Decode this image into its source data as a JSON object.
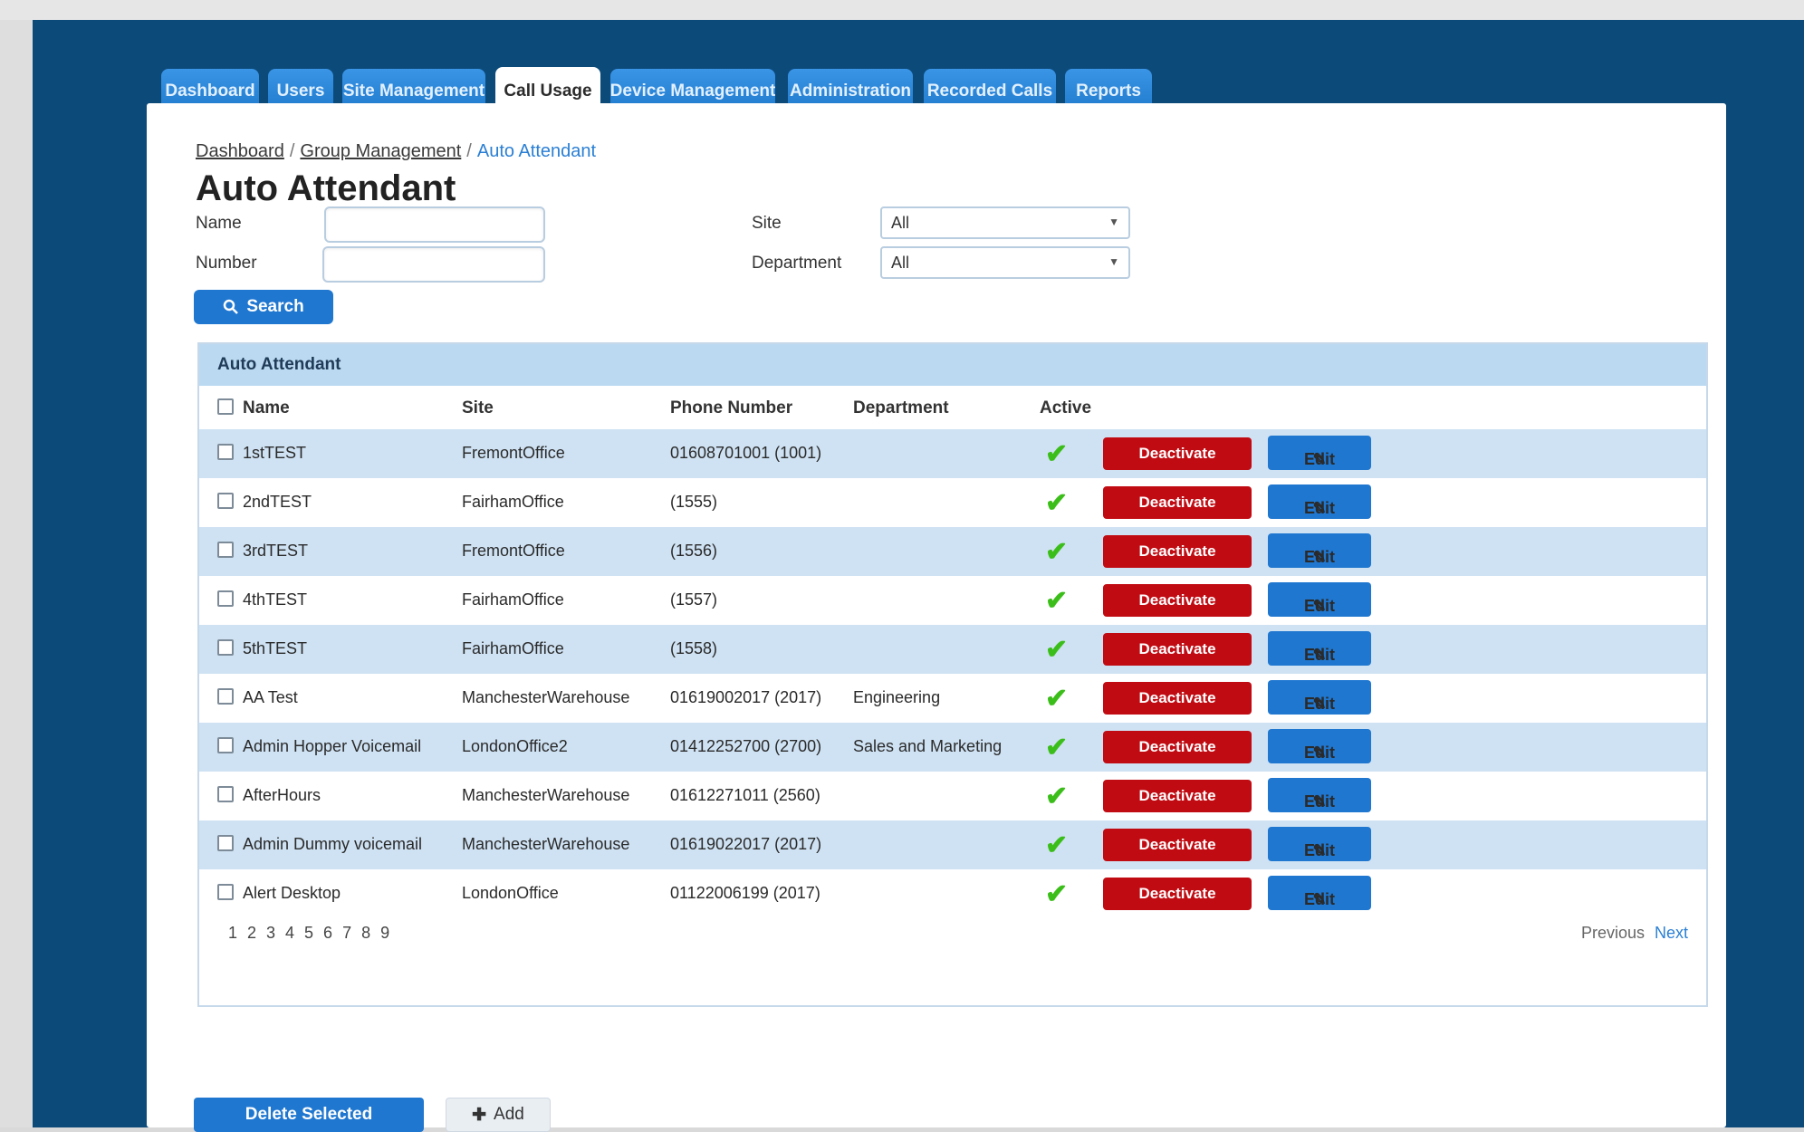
{
  "tabs": [
    {
      "label": "Dashboard"
    },
    {
      "label": "Users"
    },
    {
      "label": "Site Management"
    },
    {
      "label": "Call Usage"
    },
    {
      "label": "Device Management"
    },
    {
      "label": "Administration"
    },
    {
      "label": "Recorded Calls"
    },
    {
      "label": "Reports"
    }
  ],
  "breadcrumb": {
    "items": [
      "Dashboard",
      "Group Management"
    ],
    "current": "Auto Attendant"
  },
  "page_title": "Auto Attendant",
  "filters": {
    "name_label": "Name",
    "number_label": "Number",
    "site_label": "Site",
    "site_value": "All",
    "department_label": "Department",
    "department_value": "All",
    "search_label": "Search"
  },
  "grid": {
    "caption": "Auto Attendant",
    "columns": [
      "Name",
      "Site",
      "Phone Number",
      "Department",
      "Active"
    ],
    "deactivate_label": "Deactivate",
    "edit_label": "Edit",
    "rows": [
      {
        "name": "1stTEST",
        "site": "FremontOffice",
        "phone": "01608701001 (1001)",
        "department": ""
      },
      {
        "name": "2ndTEST",
        "site": "FairhamOffice",
        "phone": "(1555)",
        "department": ""
      },
      {
        "name": "3rdTEST",
        "site": "FremontOffice",
        "phone": "(1556)",
        "department": ""
      },
      {
        "name": "4thTEST",
        "site": "FairhamOffice",
        "phone": "(1557)",
        "department": ""
      },
      {
        "name": "5thTEST",
        "site": "FairhamOffice",
        "phone": "(1558)",
        "department": ""
      },
      {
        "name": "AA Test",
        "site": "ManchesterWarehouse",
        "phone": "01619002017 (2017)",
        "department": "Engineering"
      },
      {
        "name": "Admin Hopper Voicemail",
        "site": "LondonOffice2",
        "phone": "01412252700 (2700)",
        "department": "Sales and Marketing"
      },
      {
        "name": "AfterHours",
        "site": "ManchesterWarehouse",
        "phone": "01612271011 (2560)",
        "department": ""
      },
      {
        "name": "Admin Dummy voicemail",
        "site": "ManchesterWarehouse",
        "phone": "01619022017 (2017)",
        "department": ""
      },
      {
        "name": "Alert Desktop",
        "site": "LondonOffice",
        "phone": "01122006199 (2017)",
        "department": ""
      }
    ],
    "pages": "1 2 3 4 5 6 7 8 9",
    "prev_label": "Previous",
    "next_label": "Next"
  },
  "footer": {
    "delete_label": "Delete Selected",
    "add_label": "Add"
  },
  "colors": {
    "frame": "#0c4a7a",
    "tab": "#2a86dc",
    "primary_button": "#1f77d0",
    "danger_button": "#c10b12",
    "row_alt": "#cfe2f3",
    "active_check": "#3cbe1a"
  }
}
